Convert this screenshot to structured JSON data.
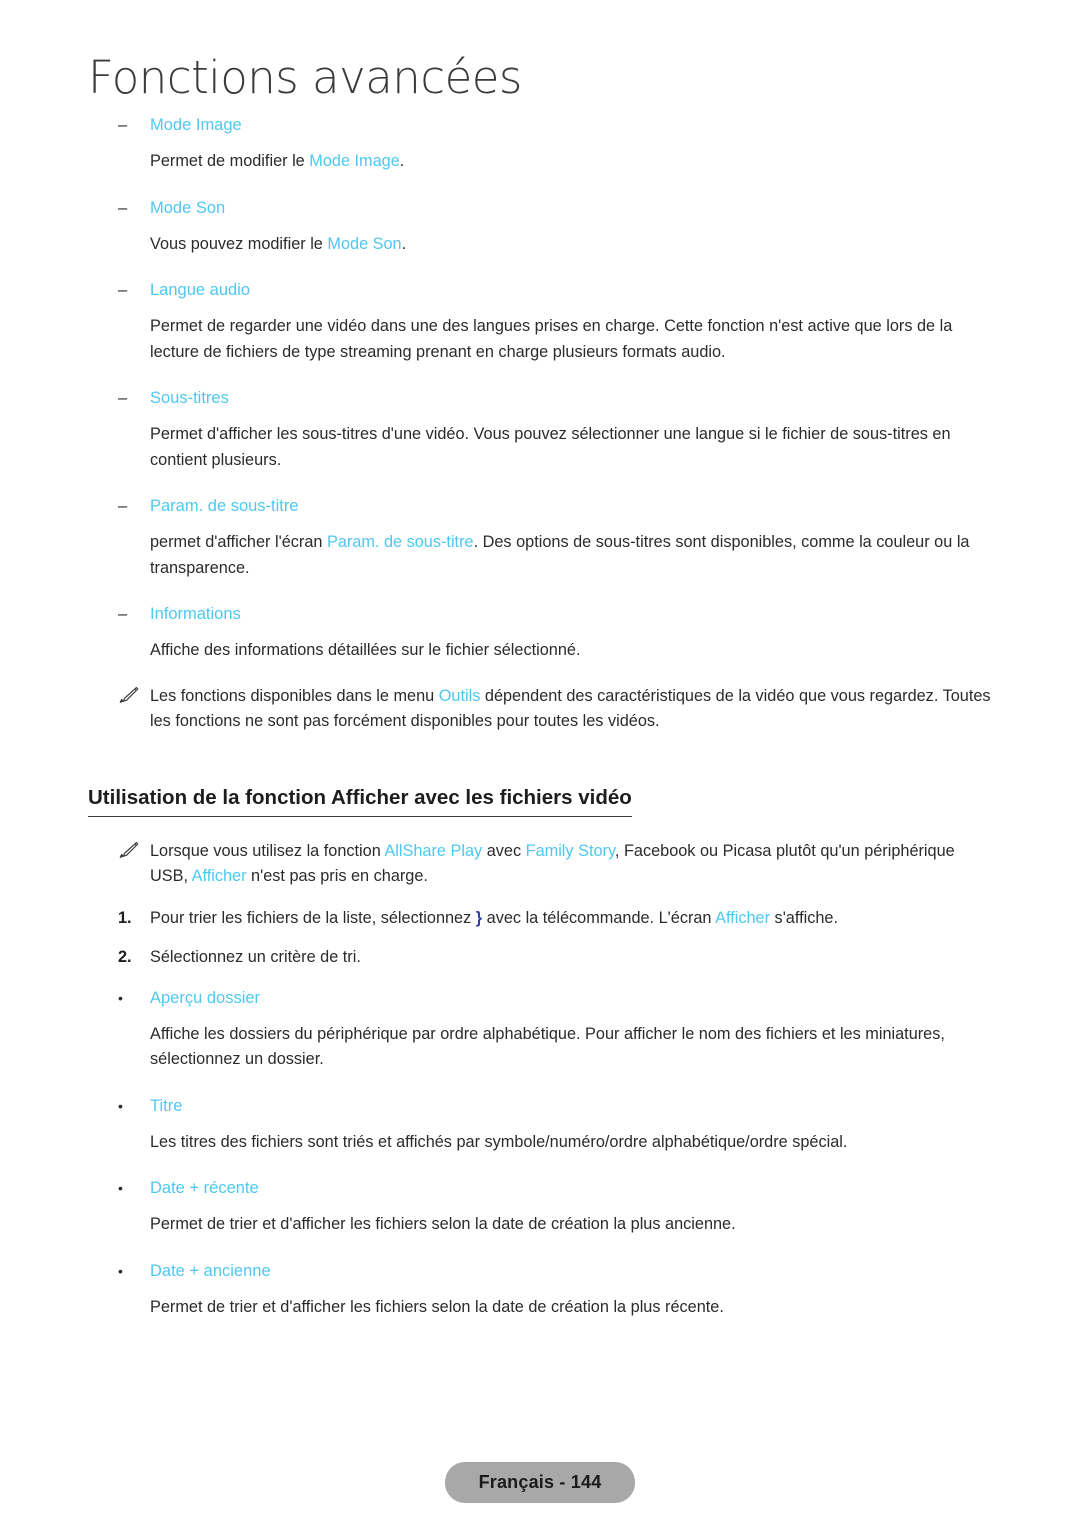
{
  "page": {
    "chapter_title": "Fonctions avancées",
    "footer_label": "Français - 144",
    "accent_color": "#4ec8f0",
    "text_color": "#2b2b2b",
    "footer_bg": "#a8a8a8"
  },
  "tool_options": [
    {
      "marker": "dash",
      "label": "Mode Image",
      "body_parts": [
        {
          "t": "Permet de modifier le ",
          "link": false
        },
        {
          "t": "Mode Image",
          "link": true
        },
        {
          "t": ".",
          "link": false
        }
      ],
      "body_plain": "Permet de modifier le Mode Image."
    },
    {
      "marker": "dash",
      "label": "Mode Son",
      "body_parts": [
        {
          "t": "Vous pouvez modifier le ",
          "link": false
        },
        {
          "t": "Mode Son",
          "link": true
        },
        {
          "t": ".",
          "link": false
        }
      ],
      "body_plain": "Vous pouvez modifier le Mode Son."
    },
    {
      "marker": "dash",
      "label": "Langue audio",
      "body_parts": [
        {
          "t": "Permet de regarder une vidéo dans une des langues prises en charge. Cette fonction n'est active que lors de la lecture de fichiers de type streaming prenant en charge plusieurs formats audio.",
          "link": false
        }
      ],
      "body_plain": "Permet de regarder une vidéo dans une des langues prises en charge. Cette fonction n'est active que lors de la lecture de fichiers de type streaming prenant en charge plusieurs formats audio."
    },
    {
      "marker": "dash",
      "label": "Sous-titres",
      "body_parts": [
        {
          "t": "Permet d'afficher les sous-titres d'une vidéo. Vous pouvez sélectionner une langue si le fichier de sous-titres en contient plusieurs.",
          "link": false
        }
      ],
      "body_plain": "Permet d'afficher les sous-titres d'une vidéo. Vous pouvez sélectionner une langue si le fichier de sous-titres en contient plusieurs."
    },
    {
      "marker": "dash",
      "label": "Param. de sous-titre",
      "body_parts": [
        {
          "t": "permet d'afficher l'écran ",
          "link": false
        },
        {
          "t": "Param. de sous-titre",
          "link": true
        },
        {
          "t": ". Des options de sous-titres sont disponibles, comme la couleur ou la transparence.",
          "link": false
        }
      ],
      "body_plain": "permet d'afficher l'écran Param. de sous-titre. Des options de sous-titres sont disponibles, comme la couleur ou la transparence."
    },
    {
      "marker": "dash",
      "label": "Informations",
      "body_parts": [
        {
          "t": "Affiche des informations détaillées sur le fichier sélectionné.",
          "link": false
        }
      ],
      "body_plain": "Affiche des informations détaillées sur le fichier sélectionné."
    }
  ],
  "note_tools": {
    "icon": "pencil-icon",
    "parts": [
      {
        "t": "Les fonctions disponibles dans le menu ",
        "link": false
      },
      {
        "t": "Outils",
        "link": true
      },
      {
        "t": " dépendent des caractéristiques de la vidéo que vous regardez. Toutes les fonctions ne sont pas forcément disponibles pour toutes les vidéos.",
        "link": false
      }
    ],
    "plain": "Les fonctions disponibles dans le menu Outils dépendent des caractéristiques de la vidéo que vous regardez. Toutes les fonctions ne sont pas forcément disponibles pour toutes les vidéos."
  },
  "section": {
    "heading": "Utilisation de la fonction Afficher avec les fichiers vidéo",
    "note": {
      "icon": "pencil-icon",
      "parts": [
        {
          "t": "Lorsque vous utilisez la fonction ",
          "link": false
        },
        {
          "t": "AllShare Play",
          "link": true
        },
        {
          "t": " avec ",
          "link": false
        },
        {
          "t": "Family Story",
          "link": true
        },
        {
          "t": ", Facebook ou Picasa plutôt qu'un périphérique USB, ",
          "link": false
        },
        {
          "t": "Afficher",
          "link": true
        },
        {
          "t": " n'est pas pris en charge.",
          "link": false
        }
      ],
      "plain": "Lorsque vous utilisez la fonction AllShare Play avec Family Story, Facebook ou Picasa plutôt qu'un périphérique USB, Afficher n'est pas pris en charge."
    },
    "steps": [
      {
        "num": "1.",
        "parts": [
          {
            "t": "Pour trier les fichiers de la liste, sélectionnez ",
            "link": false
          },
          {
            "t": "}",
            "key": true
          },
          {
            "t": " avec la télécommande. L'écran ",
            "link": false
          },
          {
            "t": "Afficher",
            "link": true
          },
          {
            "t": " s'affiche.",
            "link": false
          }
        ],
        "plain": "Pour trier les fichiers de la liste, sélectionnez } avec la télécommande. L'écran Afficher s'affiche."
      },
      {
        "num": "2.",
        "parts": [
          {
            "t": "Sélectionnez un critère de tri.",
            "link": false
          }
        ],
        "plain": "Sélectionnez un critère de tri."
      }
    ],
    "sort_options": [
      {
        "marker": "dot",
        "label": "Aperçu dossier",
        "body_parts": [
          {
            "t": "Affiche les dossiers du périphérique par ordre alphabétique. Pour afficher le nom des fichiers et les miniatures, sélectionnez un dossier.",
            "link": false
          }
        ],
        "body_plain": "Affiche les dossiers du périphérique par ordre alphabétique. Pour afficher le nom des fichiers et les miniatures, sélectionnez un dossier."
      },
      {
        "marker": "dot",
        "label": "Titre",
        "body_parts": [
          {
            "t": "Les titres des fichiers sont triés et affichés par symbole/numéro/ordre alphabétique/ordre spécial.",
            "link": false
          }
        ],
        "body_plain": "Les titres des fichiers sont triés et affichés par symbole/numéro/ordre alphabétique/ordre spécial."
      },
      {
        "marker": "dot",
        "label": "Date + récente",
        "body_parts": [
          {
            "t": "Permet de trier et d'afficher les fichiers selon la date de création la plus ancienne.",
            "link": false
          }
        ],
        "body_plain": "Permet de trier et d'afficher les fichiers selon la date de création la plus ancienne."
      },
      {
        "marker": "dot",
        "label": "Date + ancienne",
        "body_parts": [
          {
            "t": "Permet de trier et d'afficher les fichiers selon la date de création la plus récente.",
            "link": false
          }
        ],
        "body_plain": "Permet de trier et d'afficher les fichiers selon la date de création la plus récente."
      }
    ]
  }
}
